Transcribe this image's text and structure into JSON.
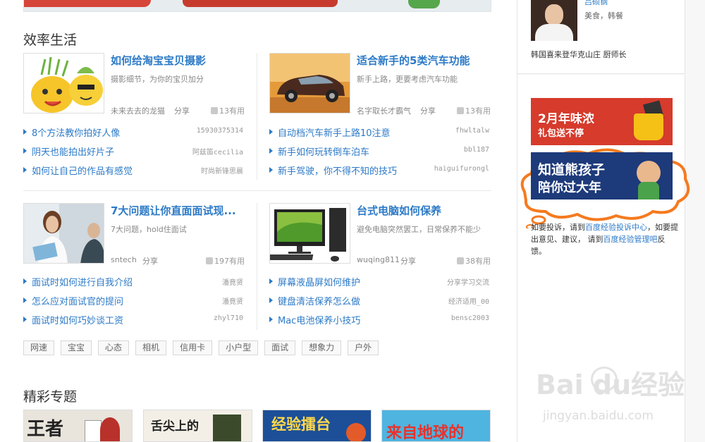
{
  "sections": {
    "efficiency_title": "效率生活",
    "topics_title": "精彩专题"
  },
  "cards": [
    {
      "title": "如何给淘宝宝贝摄影",
      "desc": "摄影细节，为你的宝贝加分",
      "author": "未来去去的龙猫",
      "share": "分享",
      "useful": "13有用"
    },
    {
      "title": "适合新手的5类汽车功能",
      "desc": "新手上路，更要考虑汽车功能",
      "author": "名字取长才霸气",
      "share": "分享",
      "useful": "13有用"
    },
    {
      "title": "7大问题让你直面面试现...",
      "desc": "7大问题，hold住面试",
      "author": "sntech",
      "share": "分享",
      "useful": "197有用"
    },
    {
      "title": "台式电脑如何保养",
      "desc": "避免电脑突然罢工，日常保养不能少",
      "author": "wuqing811",
      "share": "分享",
      "useful": "38有用"
    }
  ],
  "lists": [
    [
      {
        "text": "8个方法教你拍好人像",
        "author": "15930375314"
      },
      {
        "text": "阴天也能拍出好片子",
        "author": "阿兹笛cecilia"
      },
      {
        "text": "如何让自己的作品有感觉",
        "author": "时尚新锋思晨"
      }
    ],
    [
      {
        "text": "自动档汽车新手上路10注意",
        "author": "fhwltalw"
      },
      {
        "text": "新手如何玩转倒车泊车",
        "author": "bbl187"
      },
      {
        "text": "新手驾驶，你不得不知的技巧",
        "author": "haiguifurongl"
      }
    ],
    [
      {
        "text": "面试时如何进行自我介绍",
        "author": "潘竟贤"
      },
      {
        "text": "怎么应对面试官的提问",
        "author": "潘竟贤"
      },
      {
        "text": "面试时如何巧妙谈工资",
        "author": "zhyl710"
      }
    ],
    [
      {
        "text": "屏幕液晶屏如何维护",
        "author": "分享学习交流"
      },
      {
        "text": "键盘清洁保养怎么做",
        "author": "经济适用_00"
      },
      {
        "text": "Mac电池保养小技巧",
        "author": "bensc2003"
      }
    ]
  ],
  "tags": [
    "网速",
    "宝宝",
    "心态",
    "相机",
    "信用卡",
    "小户型",
    "面试",
    "想象力",
    "户外"
  ],
  "topics": [
    {
      "label": "王者"
    },
    {
      "label": "舌尖上的"
    },
    {
      "label": "经验擂台"
    },
    {
      "label": "来自地球的"
    }
  ],
  "sidebar": {
    "chef_name": "吕硕钢",
    "chef_tags": "美食，韩餐",
    "chef_title": "韩国喜来登华克山庄  厨师长",
    "promo1_line1": "2月年味浓",
    "promo1_line2": "礼包送不停",
    "promo2_line1": "知道熊孩子",
    "promo2_line2": "陪你过大年",
    "notice_prefix": "如要投诉，请到",
    "notice_link1": "百度经验投诉中心",
    "notice_mid": "，如要提出意见、建议， 请到",
    "notice_link2": "百度经验管理吧",
    "notice_suffix": "反馈。"
  },
  "watermark": {
    "brand": "Bai  du经验",
    "url": "jingyan.baidu.com"
  },
  "colors": {
    "link_blue": "#2c7ac7",
    "promo_red": "#d63b2c",
    "promo_navy": "#1d3a7a",
    "cloud_orange": "#f57a1f"
  }
}
